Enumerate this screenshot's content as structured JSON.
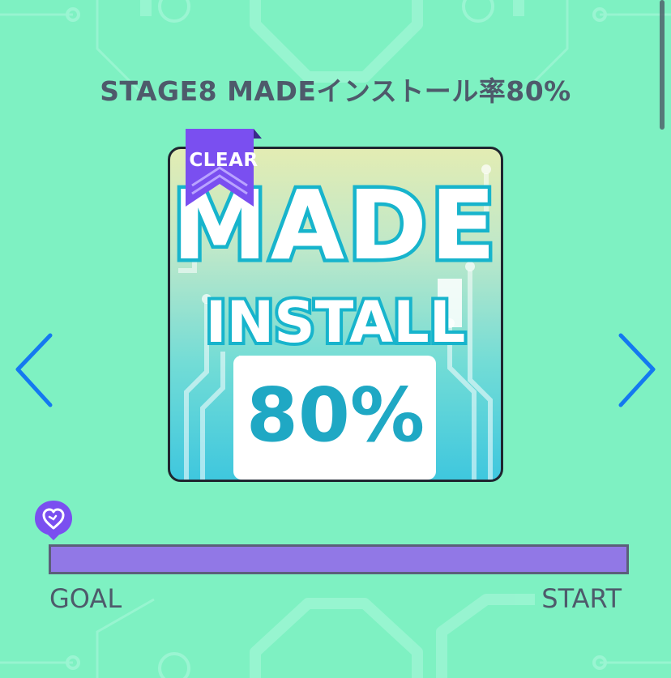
{
  "stage": {
    "title": "STAGE8 MADEインストール率80%",
    "jacket": {
      "line1": "MADE",
      "line2": "INSTALL",
      "line3": "80%",
      "badge": "CLEAR"
    }
  },
  "navigation": {
    "prev_icon": "chevron-left-icon",
    "next_icon": "chevron-right-icon"
  },
  "progress": {
    "fraction": 1.0,
    "goal_label": "GOAL",
    "start_label": "START",
    "marker_icon": "heart-pin-icon"
  },
  "colors": {
    "background": "#7ef1c2",
    "accent_blue": "#1479f0",
    "ribbon_purple": "#7a4ff0",
    "progress_fill": "#9178e6",
    "text": "#4e5a6b"
  }
}
